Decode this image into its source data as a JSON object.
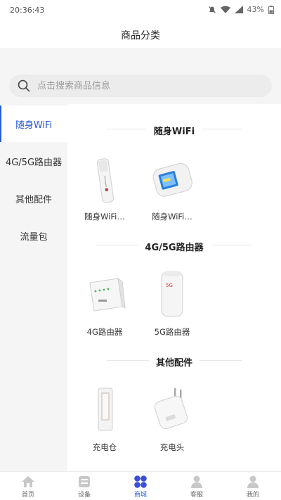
{
  "status_bar": {
    "time": "20:36:43",
    "battery": "43%"
  },
  "header": {
    "title": "商品分类"
  },
  "search": {
    "placeholder": "点击搜索商品信息"
  },
  "sidebar": {
    "items": [
      {
        "label": "随身WiFi",
        "active": true
      },
      {
        "label": "4G/5G路由器",
        "active": false
      },
      {
        "label": "其他配件",
        "active": false
      },
      {
        "label": "流量包",
        "active": false
      }
    ]
  },
  "sections": [
    {
      "title": "随身WiFi",
      "products": [
        {
          "name": "随身WiFi…"
        },
        {
          "name": "随身WiFi…"
        }
      ]
    },
    {
      "title": "4G/5G路由器",
      "products": [
        {
          "name": "4G路由器"
        },
        {
          "name": "5G路由器"
        }
      ]
    },
    {
      "title": "其他配件",
      "products": [
        {
          "name": "充电仓"
        },
        {
          "name": "充电头"
        }
      ]
    }
  ],
  "tabbar": {
    "items": [
      {
        "label": "首页",
        "icon": "home-icon"
      },
      {
        "label": "设备",
        "icon": "device-icon"
      },
      {
        "label": "商城",
        "icon": "mall-icon",
        "active": true
      },
      {
        "label": "客服",
        "icon": "service-icon"
      },
      {
        "label": "我的",
        "icon": "profile-icon"
      }
    ]
  },
  "colors": {
    "accent": "#2a5bd7",
    "sidebar_bg": "#f5f5f5"
  }
}
